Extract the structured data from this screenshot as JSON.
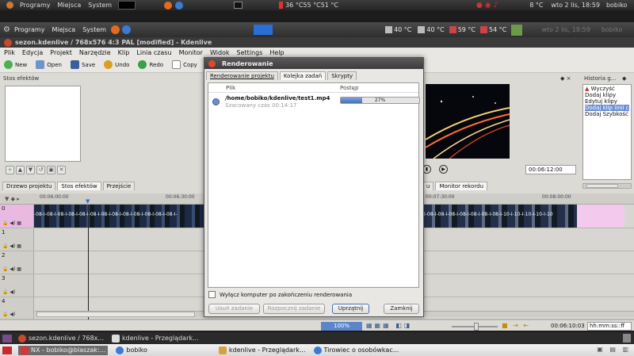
{
  "top_panel": {
    "menu": [
      "Programy",
      "Miejsca",
      "System"
    ],
    "sensors": "36 °C55 °C51 °C",
    "weather": "8 °C",
    "clock": "wto  2 lis, 18:59",
    "user": "bobiko"
  },
  "second_panel": {
    "menu": [
      "Programy",
      "Miejsca",
      "System"
    ],
    "temps": [
      "40 °C",
      "40 °C",
      "59 °C",
      "54 °C"
    ],
    "clock_ghost": "wto 2 lis, 18:59",
    "user_ghost": "bobiko"
  },
  "window": {
    "title": "sezon.kdenlive / 768x576 4:3 PAL [modified] - Kdenlive"
  },
  "menubar": [
    "Plik",
    "Edycja",
    "Projekt",
    "Narzędzie",
    "Klip",
    "Linia czasu",
    "Monitor",
    "Widok",
    "Settings",
    "Help"
  ],
  "toolbar": {
    "new": "New",
    "open": "Open",
    "save": "Save",
    "undo": "Undo",
    "redo": "Redo",
    "copy": "Copy"
  },
  "left_panel": {
    "title": "Stos efektów",
    "tabs": [
      "Drzewo projektu",
      "Stos efektów",
      "Przejście"
    ]
  },
  "monitor": {
    "timecode": "00:06:12:00",
    "tab": "Monitor rekordu",
    "tab_partial": "u"
  },
  "history": {
    "title": "Historia g...",
    "items": [
      "Wyczyść",
      "Dodaj klipy",
      "Edytuj klipy",
      "Dodaj klip linii czasu",
      "Dodaj Szybkość"
    ],
    "selected_index": 3
  },
  "timeline": {
    "ruler": [
      "00:06:00:00",
      "00:06:30:00",
      "00:07:30:00",
      "00:08:00:00"
    ],
    "tracks": [
      "0",
      "1",
      "2",
      "3",
      "4"
    ],
    "clip_labels_a": "-08-I-08-I-08-I-08-I-08-I-08-I-08-I-08-I-08-I-08-I-08-I-08-I-08-I-",
    "clip_labels_b": "I-08-I-08-I-08-I-08-I-08-I-08-I-08-I-10-I-10-I-10-I-10-I-10"
  },
  "dialog": {
    "title": "Renderowanie",
    "tabs": [
      "Renderowanie projektu",
      "Kolejka zadań",
      "Skrypty"
    ],
    "active_tab": 1,
    "col_file": "Plik",
    "col_progress": "Postęp",
    "job_file": "/home/bobiko/kdenlive/test1.mp4",
    "job_estimate": "Szacowany czas 00:14:17",
    "job_progress_label": "27%",
    "job_progress": 0.27,
    "shutdown_label": "Wyłącz komputer po zakończeniu renderowania",
    "btn_remove": "Usuń zadanie",
    "btn_start": "Rozpocznij zadanie",
    "btn_clean": "Uprzątnij",
    "btn_close": "Zamknij"
  },
  "statusbar": {
    "zoom": "100%",
    "timecode": "00:06:10:03",
    "format": "hh:mm:ss::ff"
  },
  "taskbar_top": {
    "items": [
      "sezon.kdenlive / 768x...",
      "kdenlive - Przeglądark..."
    ]
  },
  "taskbar_bottom": {
    "items": [
      "NX - bobiko@blaszak:...",
      "bobiko",
      "kdenlive - Przeglądark...",
      "Tirowiec o osobówkac..."
    ]
  },
  "colors": {
    "accent": "#4a6fb5",
    "progress": "#5b86c9",
    "selection": "#6b8fd6"
  }
}
